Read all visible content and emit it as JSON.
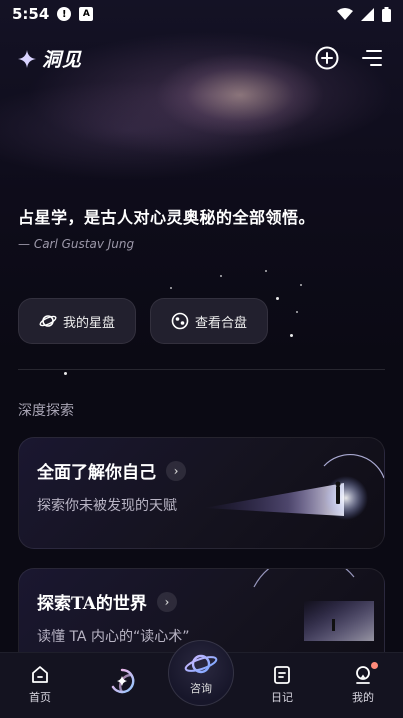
{
  "status_bar": {
    "time": "5:54",
    "icon_a": "A"
  },
  "app": {
    "name": "洞见"
  },
  "quote": {
    "text": "占星学，是古人对心灵奥秘的全部领悟。",
    "author": "— Carl Gustav Jung"
  },
  "actions": [
    {
      "label": "我的星盘",
      "icon": "planet-icon"
    },
    {
      "label": "查看合盘",
      "icon": "compatibility-icon"
    }
  ],
  "section": {
    "title": "深度探索"
  },
  "cards": [
    {
      "title": "全面了解你自己",
      "subtitle": "探索你未被发现的天赋"
    },
    {
      "title": "探索TA的世界",
      "subtitle": "读懂 TA 内心的“读心术”"
    }
  ],
  "bottom_nav": {
    "home": "首页",
    "consult": "咨询",
    "diary": "日记",
    "mine": "我的"
  },
  "colors": {
    "background": "#0b0a14",
    "accent": "#9d86ff",
    "badge": "#ff8a7a"
  }
}
